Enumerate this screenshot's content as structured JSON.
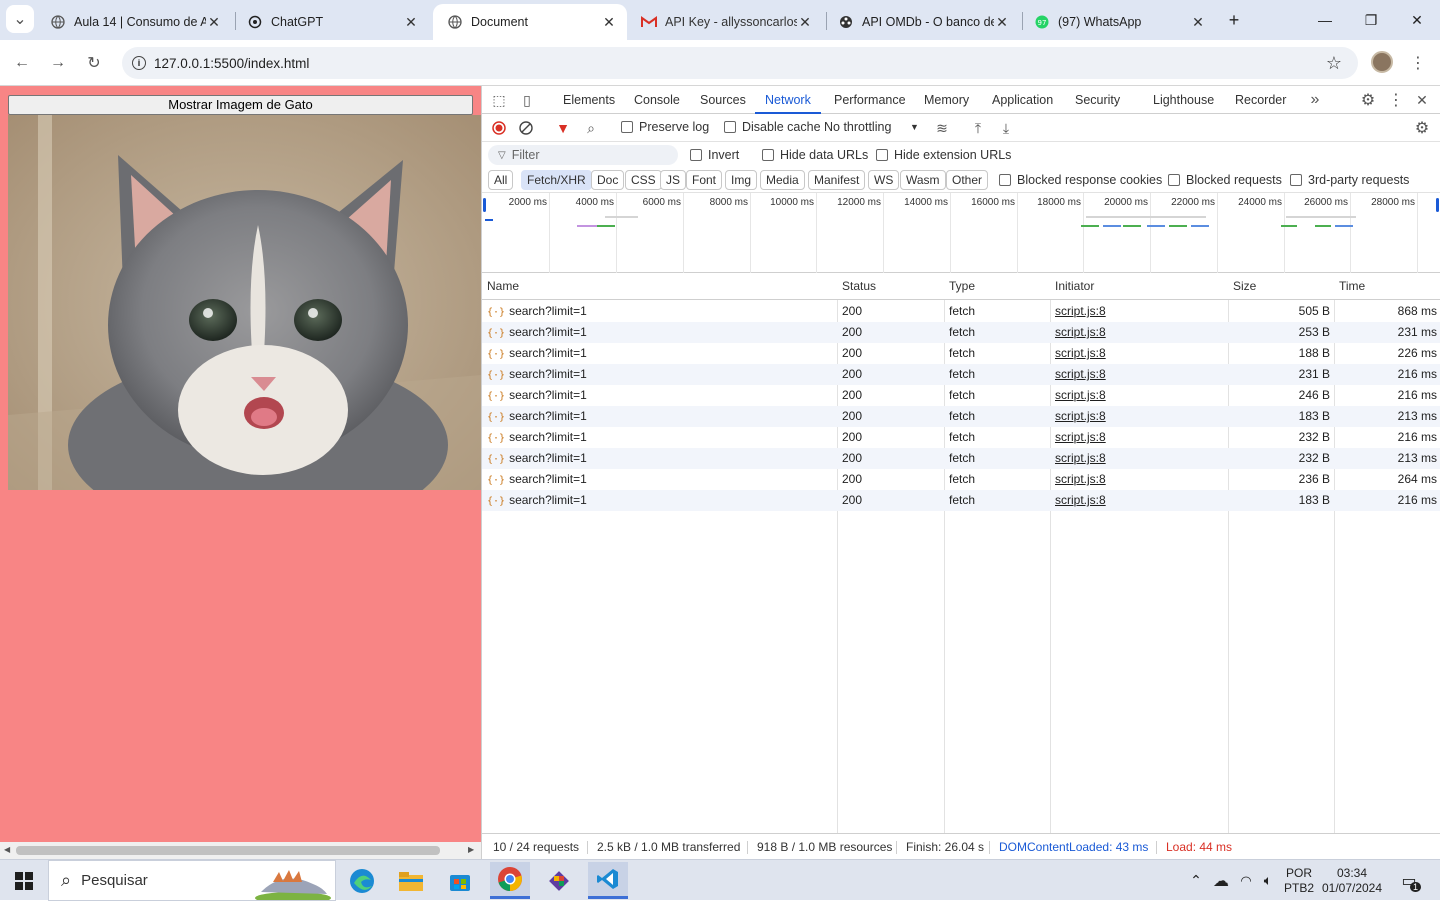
{
  "browser": {
    "tabs": [
      {
        "title": "Aula 14 | Consumo de A",
        "icon": "globe-icon",
        "active": false
      },
      {
        "title": "ChatGPT",
        "icon": "chatgpt-icon",
        "active": false
      },
      {
        "title": "Document",
        "icon": "globe-icon",
        "active": true
      },
      {
        "title": "API Key - allyssoncarlos",
        "icon": "gmail-icon",
        "active": false
      },
      {
        "title": "API OMDb - O banco de",
        "icon": "omdb-icon",
        "active": false
      },
      {
        "title": "(97) WhatsApp",
        "icon": "whatsapp-icon",
        "active": false
      }
    ],
    "new_tab": "+",
    "url": "127.0.0.1:5500/index.html"
  },
  "page": {
    "background": "#f88585",
    "button_label": "Mostrar Imagem de Gato"
  },
  "devtools": {
    "tabs": [
      "Elements",
      "Console",
      "Sources",
      "Network",
      "Performance",
      "Memory",
      "Application",
      "Security",
      "Lighthouse",
      "Recorder"
    ],
    "active_tab": "Network",
    "toolbar": {
      "preserve_log": "Preserve log",
      "disable_cache": "Disable cache",
      "throttling": "No throttling"
    },
    "filter": {
      "placeholder": "Filter",
      "invert": "Invert",
      "hide_data_urls": "Hide data URLs",
      "hide_extension_urls": "Hide extension URLs"
    },
    "type_filters": [
      "All",
      "Fetch/XHR",
      "Doc",
      "CSS",
      "JS",
      "Font",
      "Img",
      "Media",
      "Manifest",
      "WS",
      "Wasm",
      "Other"
    ],
    "active_type": "Fetch/XHR",
    "extra_filters": {
      "blocked_cookies": "Blocked response cookies",
      "blocked_requests": "Blocked requests",
      "third_party": "3rd-party requests"
    },
    "overview_ticks": [
      "2000 ms",
      "4000 ms",
      "6000 ms",
      "8000 ms",
      "10000 ms",
      "12000 ms",
      "14000 ms",
      "16000 ms",
      "18000 ms",
      "20000 ms",
      "22000 ms",
      "24000 ms",
      "26000 ms",
      "28000 ms"
    ],
    "columns": [
      "Name",
      "Status",
      "Type",
      "Initiator",
      "Size",
      "Time"
    ],
    "rows": [
      {
        "name": "search?limit=1",
        "status": "200",
        "type": "fetch",
        "initiator": "script.js:8",
        "size": "505 B",
        "time": "868 ms"
      },
      {
        "name": "search?limit=1",
        "status": "200",
        "type": "fetch",
        "initiator": "script.js:8",
        "size": "253 B",
        "time": "231 ms"
      },
      {
        "name": "search?limit=1",
        "status": "200",
        "type": "fetch",
        "initiator": "script.js:8",
        "size": "188 B",
        "time": "226 ms"
      },
      {
        "name": "search?limit=1",
        "status": "200",
        "type": "fetch",
        "initiator": "script.js:8",
        "size": "231 B",
        "time": "216 ms"
      },
      {
        "name": "search?limit=1",
        "status": "200",
        "type": "fetch",
        "initiator": "script.js:8",
        "size": "246 B",
        "time": "216 ms"
      },
      {
        "name": "search?limit=1",
        "status": "200",
        "type": "fetch",
        "initiator": "script.js:8",
        "size": "183 B",
        "time": "213 ms"
      },
      {
        "name": "search?limit=1",
        "status": "200",
        "type": "fetch",
        "initiator": "script.js:8",
        "size": "232 B",
        "time": "216 ms"
      },
      {
        "name": "search?limit=1",
        "status": "200",
        "type": "fetch",
        "initiator": "script.js:8",
        "size": "232 B",
        "time": "213 ms"
      },
      {
        "name": "search?limit=1",
        "status": "200",
        "type": "fetch",
        "initiator": "script.js:8",
        "size": "236 B",
        "time": "264 ms"
      },
      {
        "name": "search?limit=1",
        "status": "200",
        "type": "fetch",
        "initiator": "script.js:8",
        "size": "183 B",
        "time": "216 ms"
      }
    ],
    "status": {
      "requests": "10 / 24 requests",
      "transferred": "2.5 kB / 1.0 MB transferred",
      "resources": "918 B / 1.0 MB resources",
      "finish": "Finish: 26.04 s",
      "dom_loaded": "DOMContentLoaded: 43 ms",
      "load": "Load: 44 ms",
      "dom_color": "#1a5ad6",
      "load_color": "#d93025"
    }
  },
  "taskbar": {
    "search_placeholder": "Pesquisar",
    "apps": [
      "edge-icon",
      "file-explorer-icon",
      "store-icon",
      "chrome-icon",
      "git-icon",
      "vscode-icon"
    ],
    "language": "POR",
    "layout": "PTB2",
    "time": "03:34",
    "date": "01/07/2024",
    "notifications": "1"
  }
}
